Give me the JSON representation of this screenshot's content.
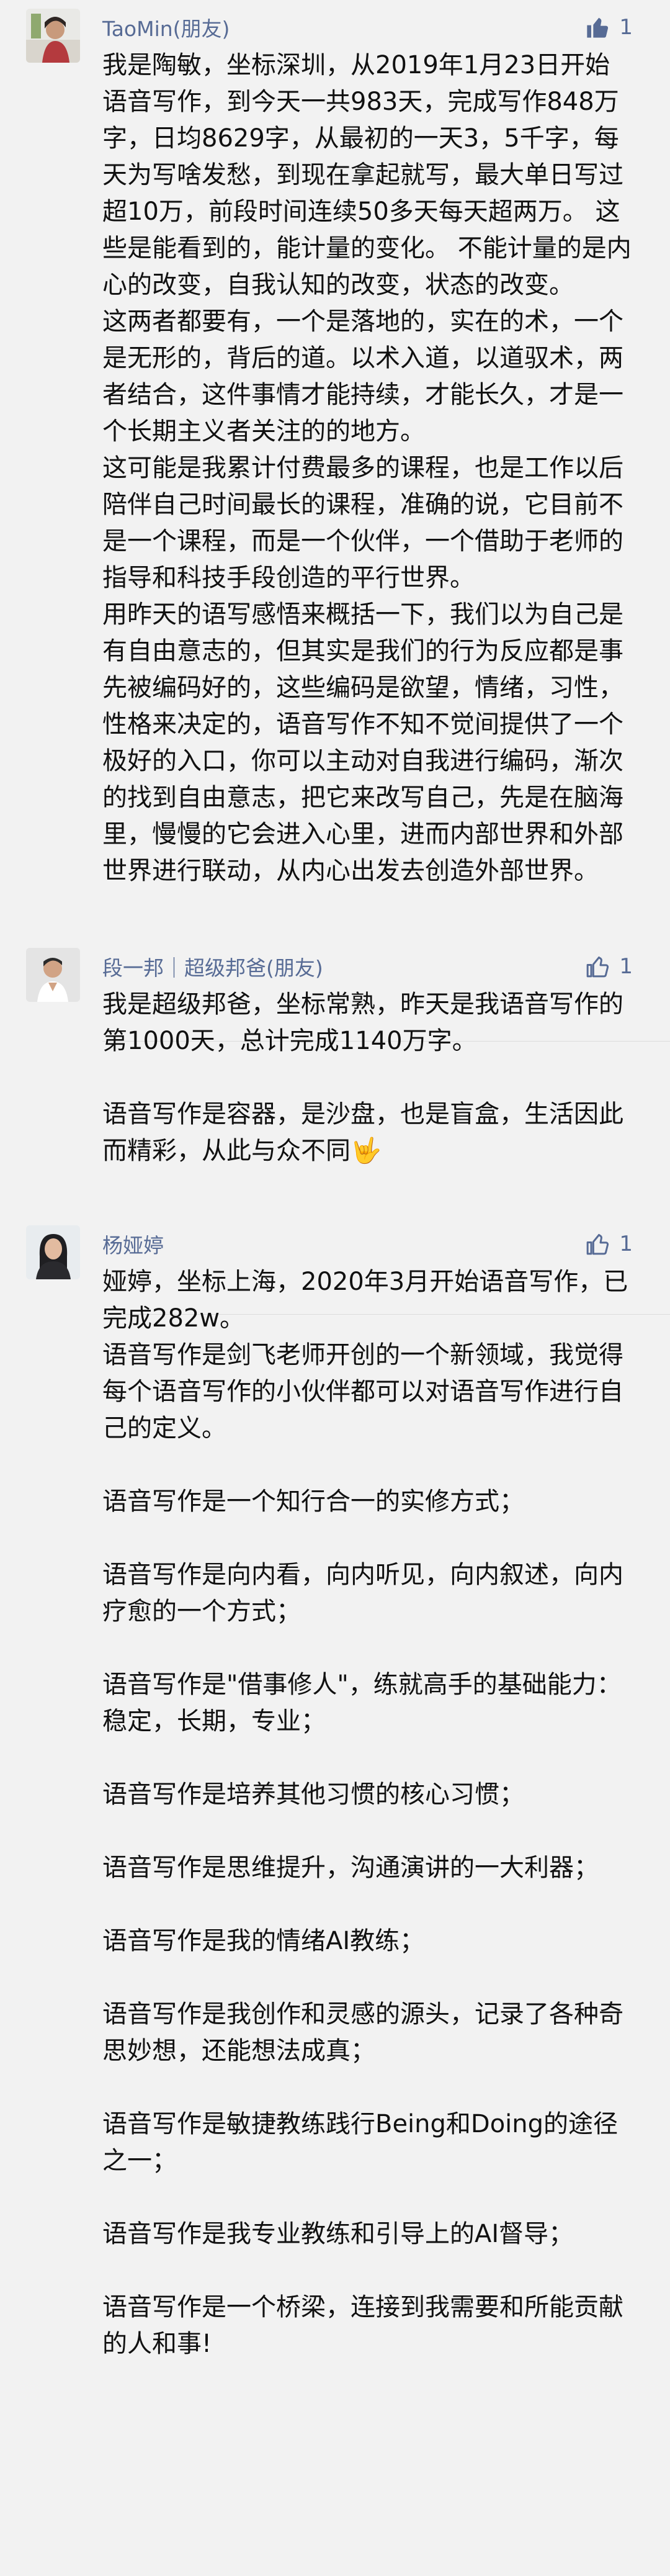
{
  "comments": [
    {
      "name": "TaoMin(朋友)",
      "likes": "1",
      "liked": true,
      "paragraphs": [
        "我是陶敏，坐标深圳，从2019年1月23日开始语音写作，到今天一共983天，完成写作848万字，日均8629字，从最初的一天3，5千字，每天为写啥发愁，到现在拿起就写，最大单日写过超10万，前段时间连续50多天每天超两万。 这些是能看到的，能计量的变化。 不能计量的是内心的改变，自我认知的改变，状态的改变。",
        "这两者都要有，一个是落地的，实在的术，一个是无形的，背后的道。以术入道，以道驭术，两者结合，这件事情才能持续，才能长久，才是一个长期主义者关注的的地方。",
        "这可能是我累计付费最多的课程，也是工作以后陪伴自己时间最长的课程，准确的说，它目前不是一个课程，而是一个伙伴，一个借助于老师的指导和科技手段创造的平行世界。",
        "用昨天的语写感悟来概括一下，我们以为自己是有自由意志的，但其实是我们的行为反应都是事先被编码好的，这些编码是欲望，情绪，习性，性格来决定的，语音写作不知不觉间提供了一个极好的入口，你可以主动对自我进行编码，渐次的找到自由意志，把它来改写自己，先是在脑海里，慢慢的它会进入心里，进而内部世界和外部世界进行联动，从内心出发去创造外部世界。"
      ]
    },
    {
      "name": "段一邦｜超级邦爸(朋友)",
      "likes": "1",
      "liked": false,
      "paragraphs": [
        "我是超级邦爸，坐标常熟，昨天是我语音写作的第1000天，总计完成1140万字。",
        "语音写作是容器，是沙盘，也是盲盒，生活因此而精彩，从此与众不同🤟"
      ]
    },
    {
      "name": "杨娅婷",
      "likes": "1",
      "liked": false,
      "paragraphs": [
        "娅婷，坐标上海，2020年3月开始语音写作，已完成282w。",
        "语音写作是剑飞老师开创的一个新领域，我觉得每个语音写作的小伙伴都可以对语音写作进行自己的定义。",
        "语音写作是一个知行合一的实修方式；",
        "语音写作是向内看，向内听见，向内叙述，向内疗愈的一个方式；",
        "语音写作是\"借事修人\"，练就高手的基础能力：稳定，长期，专业；",
        "语音写作是培养其他习惯的核心习惯；",
        "语音写作是思维提升，沟通演讲的一大利器；",
        "语音写作是我的情绪AI教练；",
        "语音写作是我创作和灵感的源头，记录了各种奇思妙想，还能想法成真；",
        "语音写作是敏捷教练践行Being和Doing的途径之一；",
        "语音写作是我专业教练和引导上的AI督导；",
        "语音写作是一个桥梁，连接到我需要和所能贡献的人和事!"
      ]
    }
  ],
  "icons": {
    "like_filled": "thumbs-up-filled-icon",
    "like_outline": "thumbs-up-outline-icon"
  },
  "colors": {
    "background": "#f2f2f2",
    "name": "#576b95",
    "text": "#111111"
  }
}
